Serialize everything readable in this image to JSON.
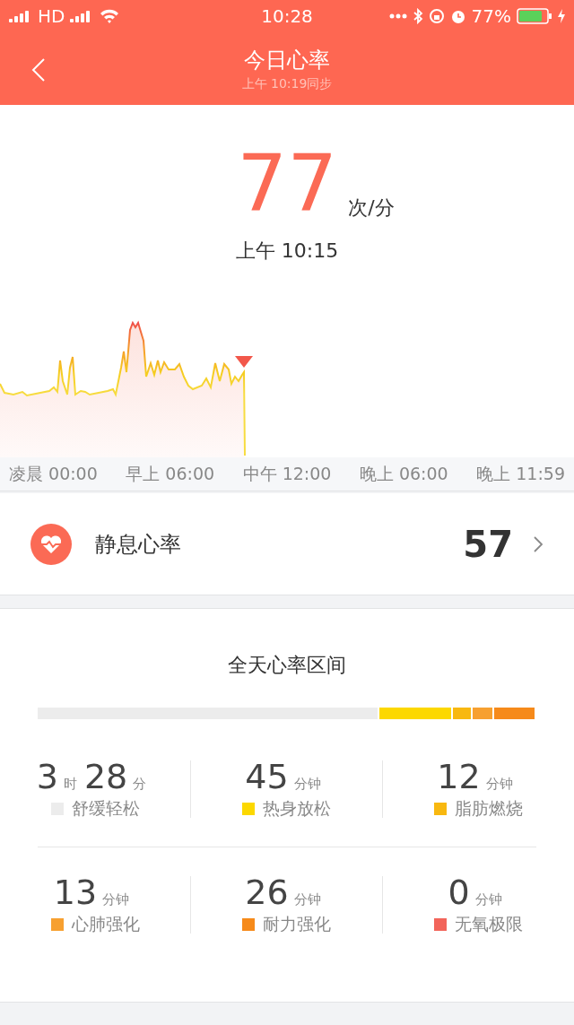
{
  "status_bar": {
    "network": "HD",
    "time": "10:28",
    "battery": "77%"
  },
  "header": {
    "title": "今日心率",
    "subtitle": "上午 10:19同步"
  },
  "current": {
    "value": "77",
    "unit": "次/分",
    "time": "上午 10:15"
  },
  "chart": {
    "axis_labels": [
      "凌晨 00:00",
      "早上 06:00",
      "中午 12:00",
      "晚上 06:00",
      "晚上 11:59"
    ]
  },
  "resting": {
    "label": "静息心率",
    "value": "57"
  },
  "zones": {
    "title": "全天心率区间",
    "items": [
      {
        "parts": [
          {
            "value": "3",
            "unit": "时"
          },
          {
            "value": "28",
            "unit": "分"
          }
        ],
        "label": "舒缓轻松",
        "color": "#ececec"
      },
      {
        "parts": [
          {
            "value": "45",
            "unit": "分钟"
          }
        ],
        "label": "热身放松",
        "color": "#fcd800"
      },
      {
        "parts": [
          {
            "value": "12",
            "unit": "分钟"
          }
        ],
        "label": "脂肪燃烧",
        "color": "#f8b810"
      },
      {
        "parts": [
          {
            "value": "13",
            "unit": "分钟"
          }
        ],
        "label": "心肺强化",
        "color": "#f7a030"
      },
      {
        "parts": [
          {
            "value": "26",
            "unit": "分钟"
          }
        ],
        "label": "耐力强化",
        "color": "#f68a1a"
      },
      {
        "parts": [
          {
            "value": "0",
            "unit": "分钟"
          }
        ],
        "label": "无氧极限",
        "color": "#f2645a"
      }
    ]
  }
}
